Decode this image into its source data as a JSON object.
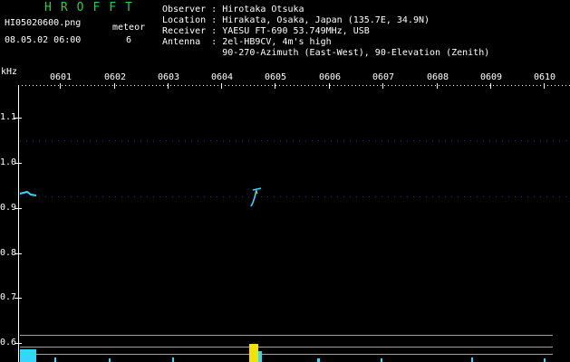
{
  "header": {
    "brand": "HROFFT",
    "filename": "HI05020600.png",
    "datetime": "08.05.02 06:00",
    "meteor_label": "meteor",
    "meteor_count": "6",
    "info": [
      "Observer : Hirotaka Otsuka",
      "Location : Hirakata, Osaka, Japan (135.7E, 34.9N)",
      "Receiver : YAESU FT-690 53.749MHz, USB",
      "Antenna  : 2el-HB9CV, 4m's high",
      "           90-270-Azimuth (East-West), 90-Elevation (Zenith)"
    ]
  },
  "axis": {
    "unit_label": "kHz",
    "x_ticks": [
      "0601",
      "0602",
      "0603",
      "0604",
      "0605",
      "0606",
      "0607",
      "0608",
      "0609",
      "0610"
    ],
    "y_ticks": [
      "1.1",
      "1.0",
      "0.9",
      "0.8",
      "0.7",
      "0.6"
    ]
  },
  "colors": {
    "brand": "#2ecc40",
    "axis": "#ffffff",
    "grid": "#3a3ad0",
    "signal_cyan": "#33d6ff",
    "signal_yellow": "#f4e200"
  }
}
